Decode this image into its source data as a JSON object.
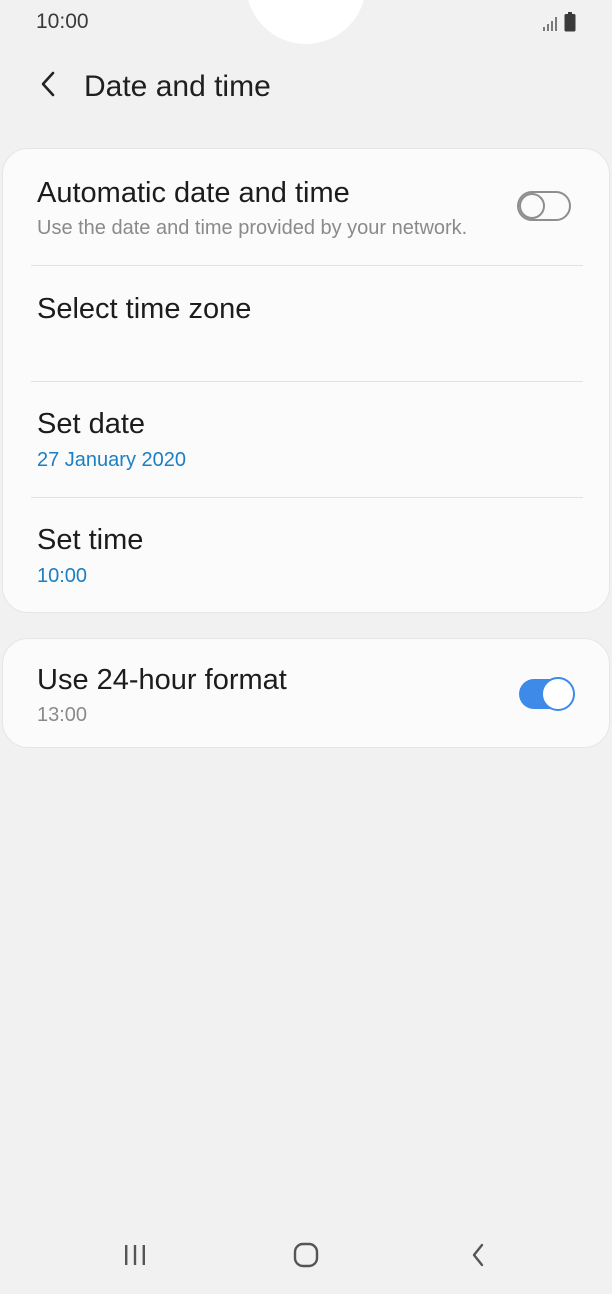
{
  "status_bar": {
    "time": "10:00",
    "signal_icon": "signal-icon",
    "battery_icon": "battery-icon"
  },
  "header": {
    "back_icon": "chevron-left-icon",
    "title": "Date and time"
  },
  "settings": {
    "automatic": {
      "title": "Automatic date and time",
      "subtitle": "Use the date and time provided by your network.",
      "enabled": false
    },
    "time_zone": {
      "title": "Select time zone"
    },
    "date": {
      "title": "Set date",
      "value": "27 January 2020"
    },
    "time": {
      "title": "Set time",
      "value": "10:00"
    },
    "format_24h": {
      "title": "Use 24-hour format",
      "value": "13:00",
      "enabled": true
    }
  },
  "nav_bar": {
    "recents_icon": "recents-icon",
    "home_icon": "home-icon",
    "back_icon": "back-icon"
  },
  "colors": {
    "accent_blue": "#1b7fc3",
    "toggle_on": "#3e8ae8",
    "background": "#f1f1f1",
    "card": "#fbfbfb"
  }
}
